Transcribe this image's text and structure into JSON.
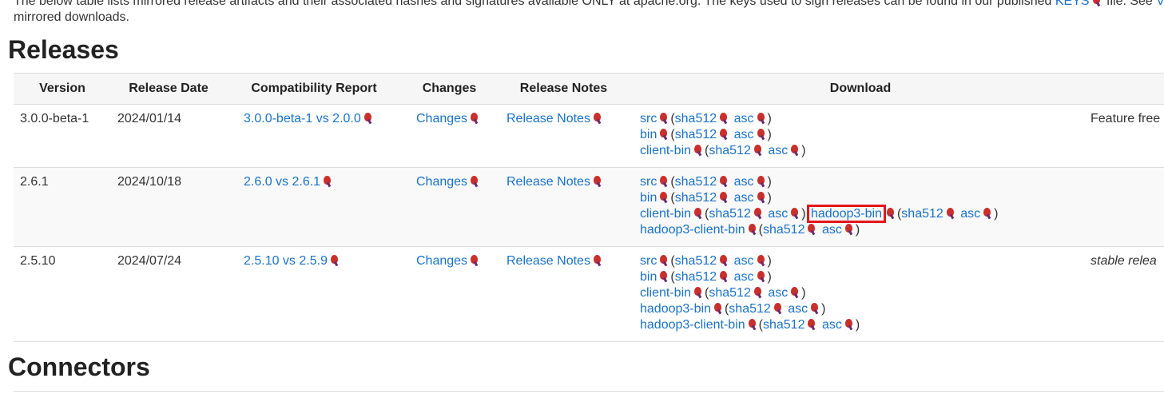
{
  "intro": {
    "line1_a": "The below table lists mirrored release artifacts and their associated hashes and signatures available ONLY at apache.org. The keys used to sign releases can be found in our published ",
    "keys_link": "KEYS",
    "line1_b": " file. See ",
    "see_link": "V",
    "line2": "mirrored downloads."
  },
  "headings": {
    "releases": "Releases",
    "connectors": "Connectors"
  },
  "table": {
    "headers": [
      "Version",
      "Release Date",
      "Compatibility Report",
      "Changes",
      "Release Notes",
      "Download",
      ""
    ],
    "rows": [
      {
        "version": "3.0.0-beta-1",
        "date": "2024/01/14",
        "compat": "3.0.0-beta-1 vs 2.0.0",
        "changes": "Changes",
        "notes": "Release Notes",
        "downloads": [
          {
            "name": "src",
            "sha": "sha512",
            "asc": "asc"
          },
          {
            "name": "bin",
            "sha": "sha512",
            "asc": "asc"
          },
          {
            "name": "client-bin",
            "sha": "sha512",
            "asc": "asc"
          }
        ],
        "remark": "Feature free"
      },
      {
        "version": "2.6.1",
        "date": "2024/10/18",
        "compat": "2.6.0 vs 2.6.1",
        "changes": "Changes",
        "notes": "Release Notes",
        "downloads": [
          {
            "name": "src",
            "sha": "sha512",
            "asc": "asc"
          },
          {
            "name": "bin",
            "sha": "sha512",
            "asc": "asc"
          },
          {
            "name": "client-bin",
            "sha": "sha512",
            "asc": "asc"
          },
          {
            "name": "hadoop3-bin",
            "sha": "sha512",
            "asc": "asc"
          },
          {
            "name": "hadoop3-client-bin",
            "sha": "sha512",
            "asc": "asc"
          }
        ],
        "remark": ""
      },
      {
        "version": "2.5.10",
        "date": "2024/07/24",
        "compat": "2.5.10 vs 2.5.9",
        "changes": "Changes",
        "notes": "Release Notes",
        "downloads": [
          {
            "name": "src",
            "sha": "sha512",
            "asc": "asc"
          },
          {
            "name": "bin",
            "sha": "sha512",
            "asc": "asc"
          },
          {
            "name": "client-bin",
            "sha": "sha512",
            "asc": "asc"
          },
          {
            "name": "hadoop3-bin",
            "sha": "sha512",
            "asc": "asc"
          },
          {
            "name": "hadoop3-client-bin",
            "sha": "sha512",
            "asc": "asc"
          }
        ],
        "remark": "stable relea"
      }
    ]
  },
  "colors": {
    "link": "#1a73c7",
    "highlight": "#e5161b",
    "feather_icon": "#c9302c"
  }
}
